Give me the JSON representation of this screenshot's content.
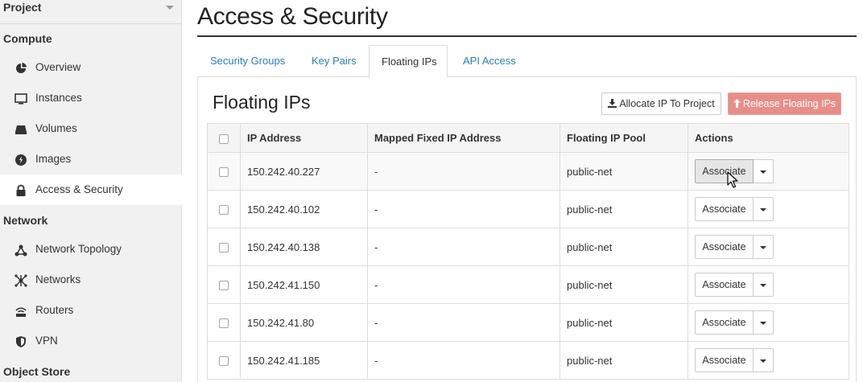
{
  "sidebar": {
    "project_label": "Project",
    "sections": {
      "compute": "Compute",
      "network": "Network",
      "object_store": "Object Store"
    },
    "compute_items": [
      {
        "label": "Overview",
        "icon": "dashboard-icon"
      },
      {
        "label": "Instances",
        "icon": "monitor-icon"
      },
      {
        "label": "Volumes",
        "icon": "hdd-icon"
      },
      {
        "label": "Images",
        "icon": "image-disc-icon"
      },
      {
        "label": "Access & Security",
        "icon": "lock-icon",
        "active": true
      }
    ],
    "network_items": [
      {
        "label": "Network Topology",
        "icon": "topology-icon"
      },
      {
        "label": "Networks",
        "icon": "networks-icon"
      },
      {
        "label": "Routers",
        "icon": "router-icon"
      },
      {
        "label": "VPN",
        "icon": "shield-icon"
      }
    ]
  },
  "page": {
    "title": "Access & Security",
    "tabs": [
      {
        "label": "Security Groups",
        "active": false
      },
      {
        "label": "Key Pairs",
        "active": false
      },
      {
        "label": "Floating IPs",
        "active": true
      },
      {
        "label": "API Access",
        "active": false
      }
    ]
  },
  "panel": {
    "title": "Floating IPs",
    "allocate_label": "Allocate IP To Project",
    "release_label": "Release Floating IPs",
    "colors": {
      "danger": "#e88e89",
      "link": "#2a7fbf"
    }
  },
  "table": {
    "headers": [
      "IP Address",
      "Mapped Fixed IP Address",
      "Floating IP Pool",
      "Actions"
    ],
    "rows": [
      {
        "ip": "150.242.40.227",
        "mapped": "-",
        "pool": "public-net",
        "action": "Associate"
      },
      {
        "ip": "150.242.40.102",
        "mapped": "-",
        "pool": "public-net",
        "action": "Associate"
      },
      {
        "ip": "150.242.40.138",
        "mapped": "-",
        "pool": "public-net",
        "action": "Associate"
      },
      {
        "ip": "150.242.41.150",
        "mapped": "-",
        "pool": "public-net",
        "action": "Associate"
      },
      {
        "ip": "150.242.41.80",
        "mapped": "-",
        "pool": "public-net",
        "action": "Associate"
      },
      {
        "ip": "150.242.41.185",
        "mapped": "-",
        "pool": "public-net",
        "action": "Associate"
      }
    ]
  }
}
